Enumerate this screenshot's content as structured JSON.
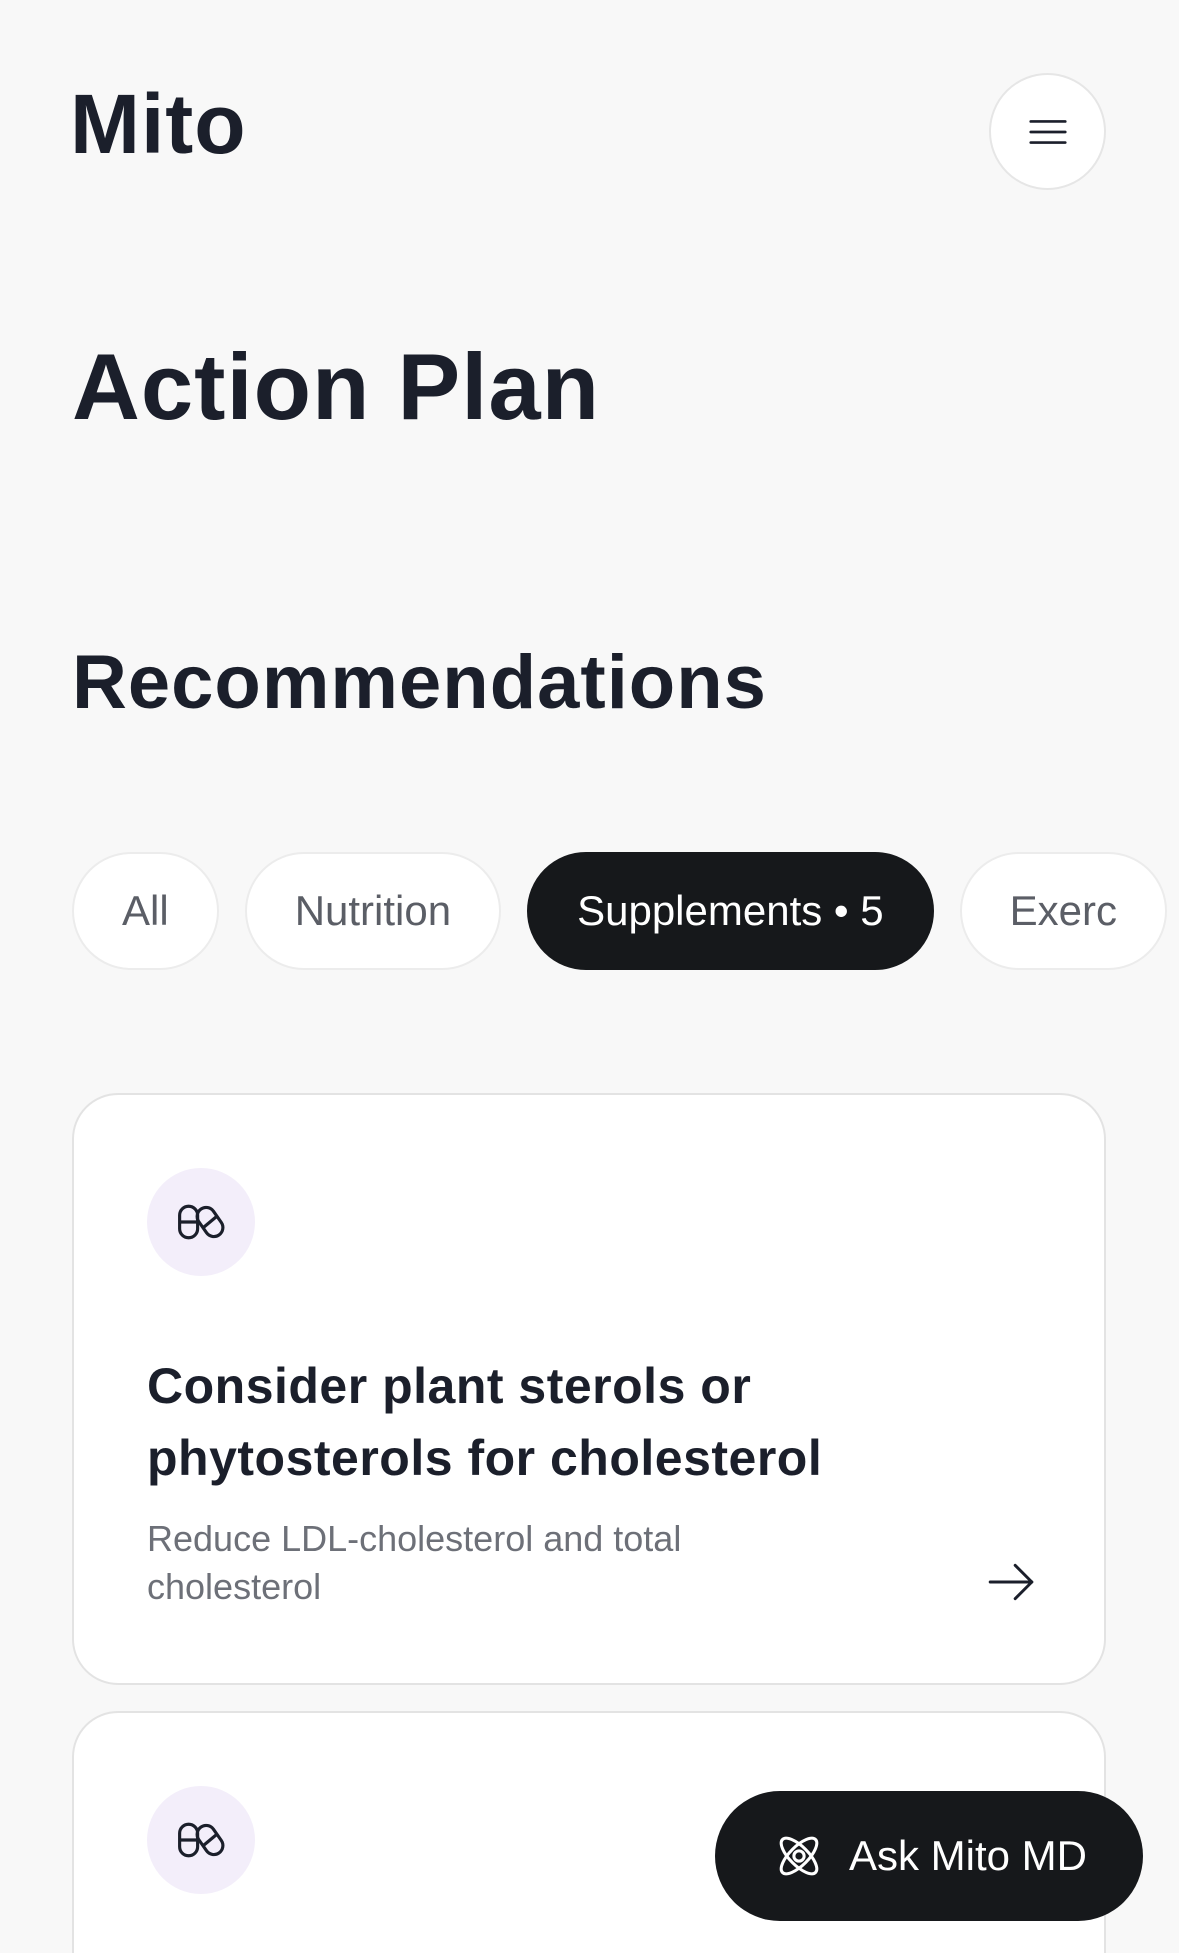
{
  "header": {
    "logo": "Mito",
    "menu_icon": "hamburger-menu-icon"
  },
  "page_title": "Action Plan",
  "section_title": "Recommendations",
  "filters": {
    "chips": [
      {
        "label": "All",
        "active": false
      },
      {
        "label": "Nutrition",
        "active": false
      },
      {
        "label": "Supplements • 5",
        "active": true
      },
      {
        "label": "Exerc",
        "active": false
      }
    ]
  },
  "cards": [
    {
      "icon": "pill-capsule-icon",
      "title": "Consider plant sterols or phytosterols for cholesterol",
      "subtitle": "Reduce LDL-cholesterol and total cholesterol",
      "arrow_icon": "arrow-right-icon"
    },
    {
      "icon": "pill-capsule-icon"
    }
  ],
  "ask_button": {
    "label": "Ask Mito MD",
    "icon": "atom-icon"
  },
  "colors": {
    "background": "#f8f8f8",
    "text_primary": "#1b1f2b",
    "text_secondary": "#6d7078",
    "active_chip": "#16181b",
    "icon_badge_bg": "#f3eefa"
  }
}
